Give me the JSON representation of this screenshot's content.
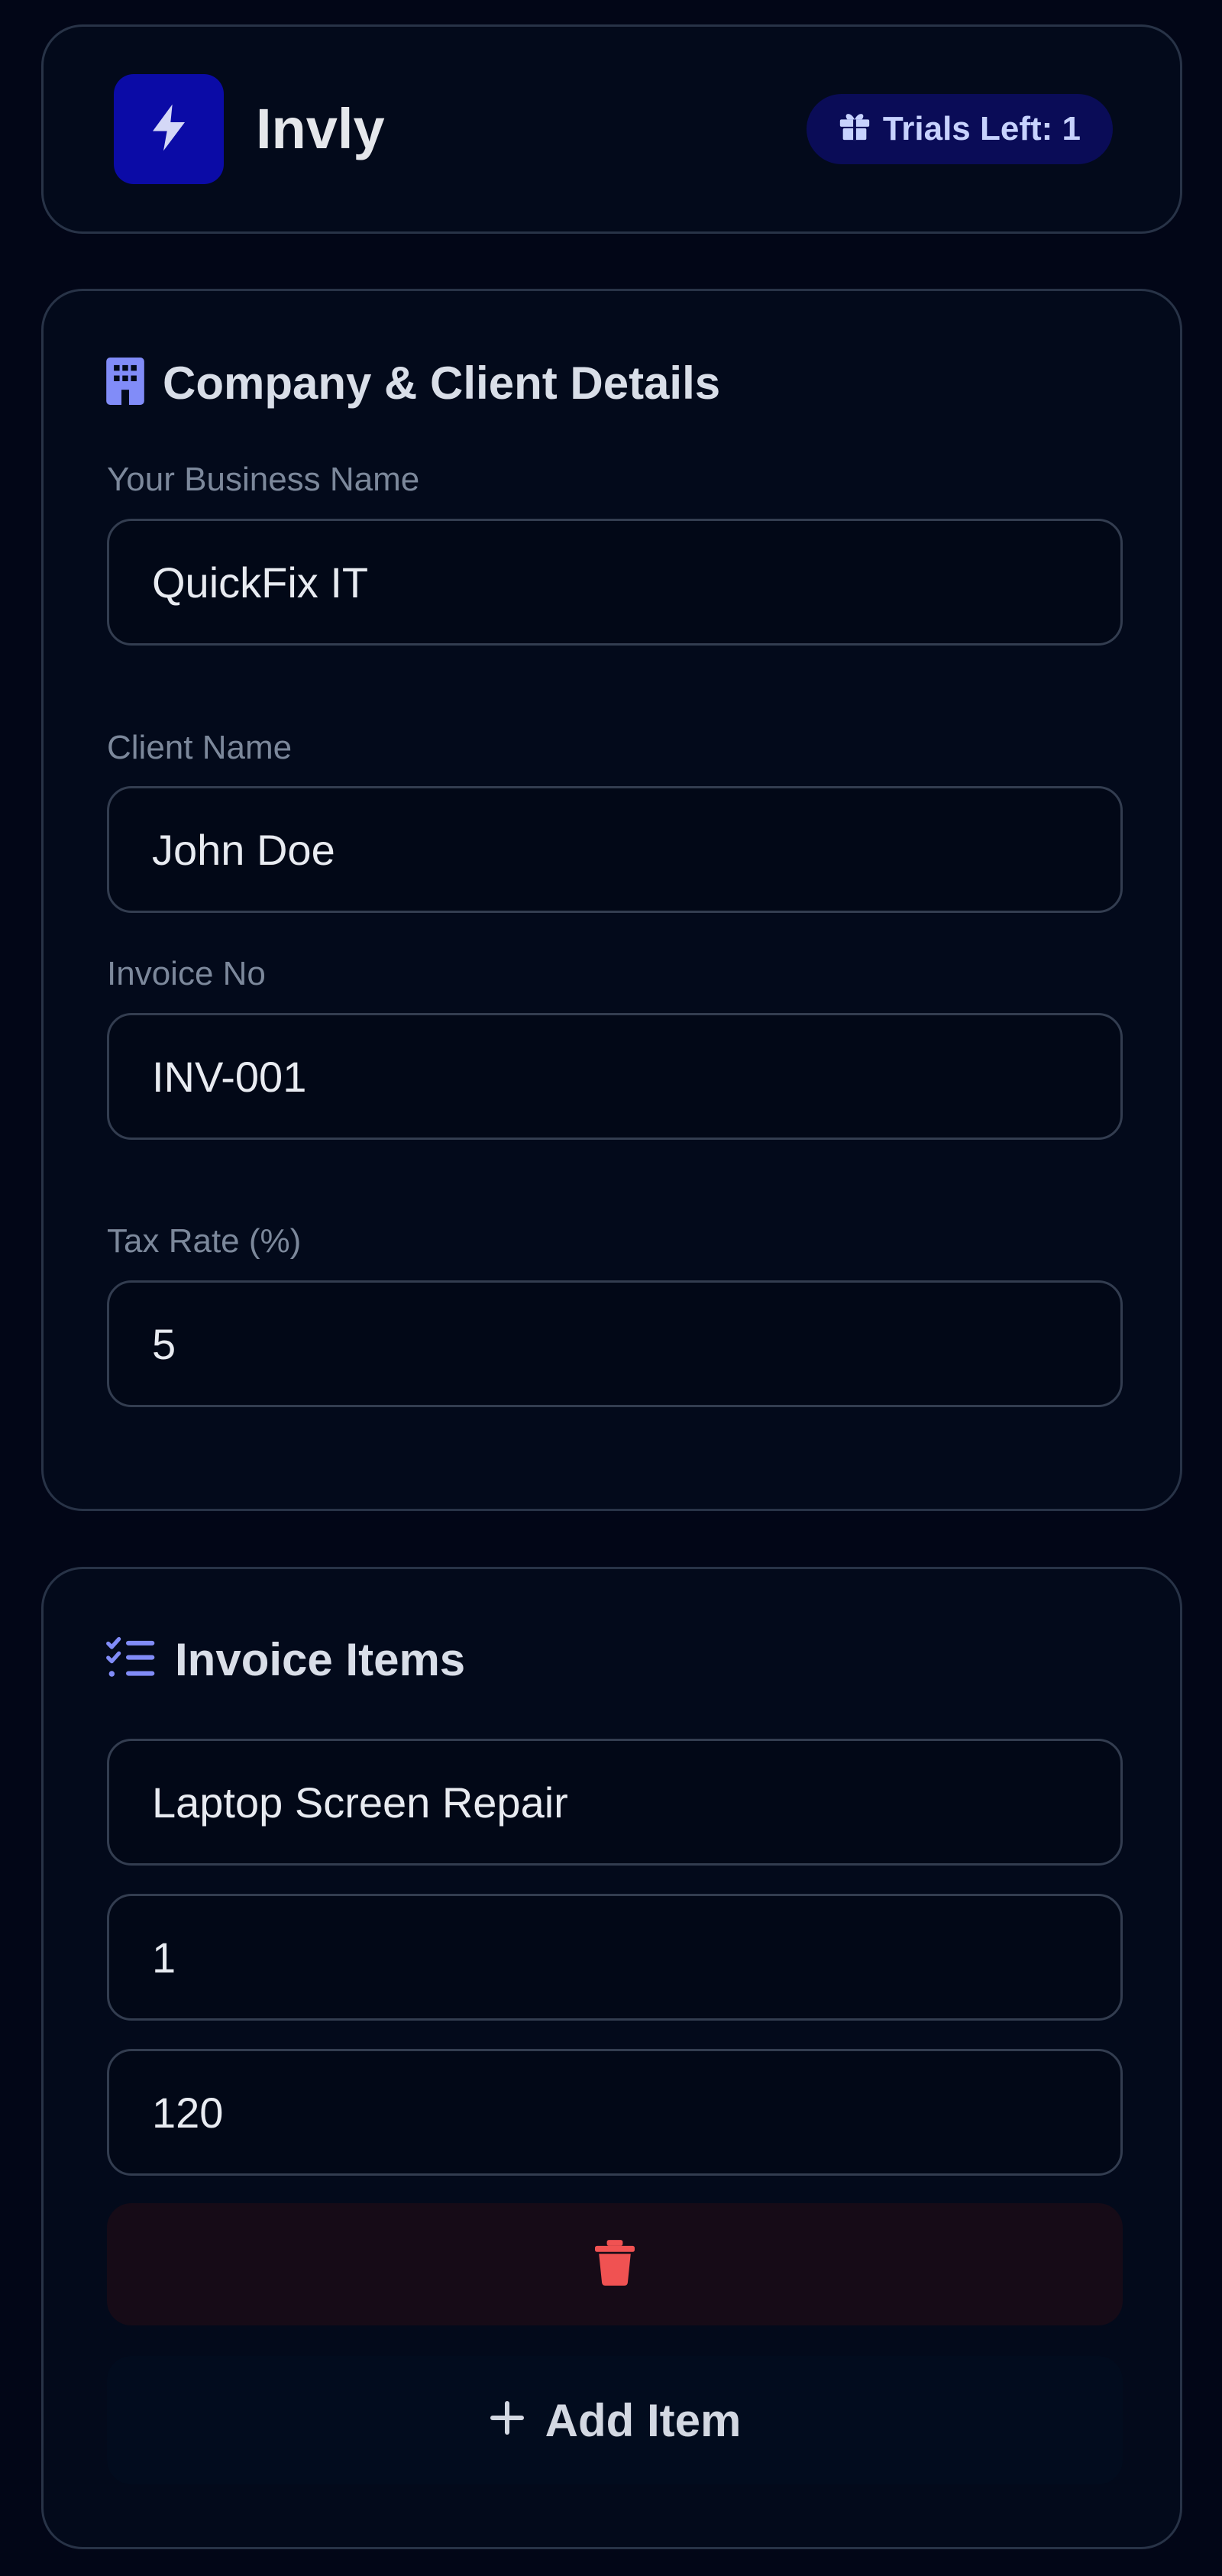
{
  "header": {
    "app_title": "Invly",
    "logo_icon": "lightning-bolt-icon",
    "trials_badge": "Trials Left: 1",
    "trials_icon": "gift-icon"
  },
  "details": {
    "title": "Company & Client Details",
    "icon": "building-icon",
    "fields": [
      {
        "label": "Your Business Name",
        "value": "QuickFix IT"
      },
      {
        "label": "Client Name",
        "value": "John Doe"
      },
      {
        "label": "Invoice No",
        "value": "INV-001"
      },
      {
        "label": "Tax Rate (%)",
        "value": "5"
      }
    ]
  },
  "items": {
    "title": "Invoice Items",
    "icon": "checklist-icon",
    "rows": [
      {
        "description": "Laptop Screen Repair",
        "quantity": "1",
        "price": "120"
      }
    ],
    "delete_icon": "trash-icon",
    "add_label": "Add Item",
    "add_icon": "plus-icon"
  },
  "colors": {
    "background": "#020617",
    "card": "#030a1b",
    "accent": "#818cf8",
    "logo_bg": "#0b0ba6",
    "delete": "#f05252"
  }
}
